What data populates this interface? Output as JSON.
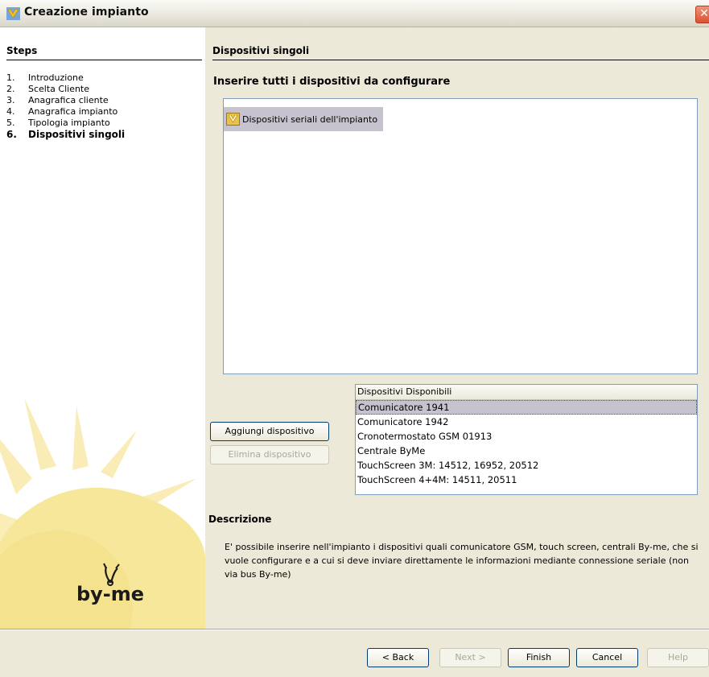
{
  "window": {
    "title": "Creazione impianto",
    "close_glyph": "✕"
  },
  "steps": {
    "heading": "Steps",
    "items": [
      {
        "num": "1.",
        "label": "Introduzione"
      },
      {
        "num": "2.",
        "label": "Scelta Cliente"
      },
      {
        "num": "3.",
        "label": "Anagrafica cliente"
      },
      {
        "num": "4.",
        "label": "Anagrafica impianto"
      },
      {
        "num": "5.",
        "label": "Tipologia impianto"
      },
      {
        "num": "6.",
        "label": "Dispositivi singoli"
      }
    ],
    "current_index": 5
  },
  "logo": {
    "text": "by-me"
  },
  "page": {
    "title": "Dispositivi singoli",
    "instruction": "Inserire tutti i dispositivi da configurare",
    "tree_root_label": "Dispositivi seriali dell'impianto"
  },
  "buttons": {
    "add_device": "Aggiungi dispositivo",
    "remove_device": "Elimina dispositivo"
  },
  "device_list": {
    "header": "Dispositivi Disponibili",
    "items": [
      "Comunicatore 1941",
      "Comunicatore 1942",
      "Cronotermostato GSM 01913",
      "Centrale ByMe",
      "TouchScreen 3M: 14512, 16952, 20512",
      "TouchScreen 4+4M: 14511, 20511"
    ],
    "selected_index": 0
  },
  "description": {
    "title": "Descrizione",
    "text": "E' possibile inserire nell'impianto i dispositivi quali comunicatore GSM, touch screen, centrali By-me, che si vuole configurare e a cui si deve inviare direttamente le informazioni mediante connessione seriale (non via bus By-me)"
  },
  "footer": {
    "back": "< Back",
    "next": "Next >",
    "finish": "Finish",
    "cancel": "Cancel",
    "help": "Help"
  },
  "colors": {
    "selection": "#c7c3ce",
    "dialog_bg": "#ece9d8",
    "sun_yellow": "#f7e79a"
  }
}
